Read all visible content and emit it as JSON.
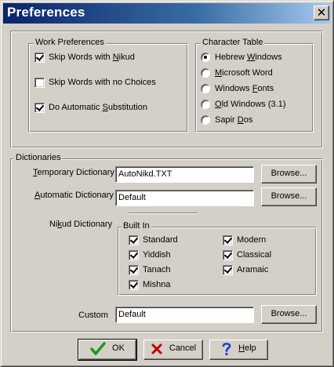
{
  "window": {
    "title": "Preferences",
    "close_glyph": "✕"
  },
  "work_prefs": {
    "legend": "Work Preferences",
    "items": [
      {
        "pre": "Skip Words with ",
        "acc": "N",
        "post": "ikud",
        "checked": true
      },
      {
        "pre": "Skip Words with no Choices",
        "acc": "",
        "post": "",
        "checked": false
      },
      {
        "pre": "Do Automatic ",
        "acc": "S",
        "post": "ubstitution",
        "checked": true
      }
    ]
  },
  "char_table": {
    "legend": "Character Table",
    "options": [
      {
        "pre": "Hebrew ",
        "acc": "W",
        "post": "indows",
        "selected": true
      },
      {
        "pre": "",
        "acc": "M",
        "post": "icrosoft Word",
        "selected": false
      },
      {
        "pre": "Windows ",
        "acc": "F",
        "post": "onts",
        "selected": false
      },
      {
        "pre": "",
        "acc": "O",
        "post": "ld Windows (3.1)",
        "selected": false
      },
      {
        "pre": "Sapir ",
        "acc": "D",
        "post": "os",
        "selected": false
      }
    ]
  },
  "dictionaries": {
    "legend": "Dictionaries",
    "temporary": {
      "pre": "",
      "acc": "T",
      "post": "emporary Dictionary",
      "value": "AutoNikd.TXT",
      "browse": "Browse..."
    },
    "automatic": {
      "pre": "",
      "acc": "A",
      "post": "utomatic Dictionary",
      "value": "Default",
      "browse": "Browse..."
    },
    "nikud": {
      "pre": "Ni",
      "acc": "k",
      "post": "ud Dictionary"
    },
    "builtin": {
      "legend": "Built In",
      "items": [
        {
          "label": "Standard",
          "checked": true
        },
        {
          "label": "Modern",
          "checked": true
        },
        {
          "label": "Yiddish",
          "checked": true
        },
        {
          "label": "Classical",
          "checked": true
        },
        {
          "label": "Tanach",
          "checked": true
        },
        {
          "label": "Aramaic",
          "checked": true
        },
        {
          "label": "Mishna",
          "checked": true
        }
      ]
    },
    "custom": {
      "label": "Custom",
      "value": "Default",
      "browse": "Browse..."
    }
  },
  "buttons": {
    "ok": "OK",
    "cancel": "Cancel",
    "help": {
      "pre": "",
      "acc": "H",
      "post": "elp"
    }
  },
  "colors": {
    "title_gradient_start": "#0a246a",
    "title_gradient_end": "#a6caf0",
    "face": "#d4d0c8",
    "ok_icon": "#1a9a1a",
    "cancel_icon": "#c00000",
    "help_icon": "#1a3fd0"
  },
  "icons": {
    "ok": "checkmark-icon",
    "cancel": "x-icon",
    "help": "question-mark-icon"
  }
}
